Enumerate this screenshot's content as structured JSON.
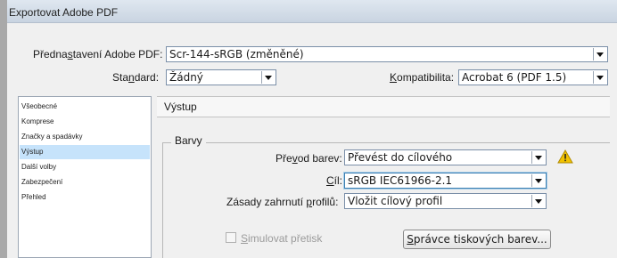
{
  "window": {
    "title": "Exportovat Adobe PDF"
  },
  "top": {
    "preset_label_pre": "Předna",
    "preset_label_u": "s",
    "preset_label_post": "tavení Adobe PDF:",
    "preset_value": "Scr-144-sRGB (změněné)",
    "standard_label_pre": "Sta",
    "standard_label_u": "n",
    "standard_label_post": "dard:",
    "standard_value": "Žádný",
    "compat_label_u": "K",
    "compat_label_post": "ompatibilita:",
    "compat_value": "Acrobat 6 (PDF 1.5)"
  },
  "sidebar": {
    "items": [
      {
        "label": "Všeobecné"
      },
      {
        "label": "Komprese"
      },
      {
        "label": "Značky a spadávky"
      },
      {
        "label": "Výstup"
      },
      {
        "label": "Další volby"
      },
      {
        "label": "Zabezpečení"
      },
      {
        "label": "Přehled"
      }
    ],
    "selected_index": 3
  },
  "panel": {
    "header": "Výstup",
    "group_title": "Barvy",
    "conversion_label_pre": "Pře",
    "conversion_label_u": "v",
    "conversion_label_post": "od barev:",
    "conversion_value": "Převést do cílového",
    "target_label_u": "C",
    "target_label_post": "íl:",
    "target_value": "sRGB IEC61966-2.1",
    "profile_label_pre": "Zásady zahrnutí ",
    "profile_label_u": "p",
    "profile_label_post": "rofilů:",
    "profile_value": "Vložit cílový profil",
    "simulate_u": "S",
    "simulate_post": "imulovat přetisk",
    "ink_manager_pre": "",
    "ink_manager_u": "S",
    "ink_manager_post": "právce tiskových barev..."
  },
  "colors": {
    "selection": "#c6e3fb",
    "warning": "#f2c200"
  }
}
